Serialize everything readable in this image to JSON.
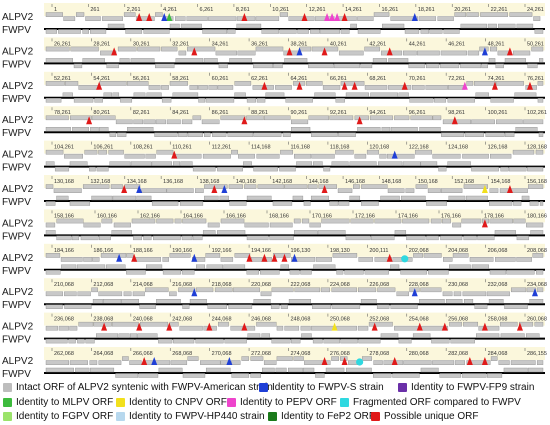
{
  "colors": {
    "band_bg": "#fbf7dc",
    "orf_fill": "#c8c8c8",
    "orf_stroke": "#8a8a8a",
    "fwpv_line": "#000000",
    "label": "#1a1a1a"
  },
  "blocks": [
    {
      "ticks": [
        "1",
        "261",
        "2,261",
        "4,261",
        "6,261",
        "8,261",
        "10,261",
        "12,261",
        "14,261",
        "16,261",
        "18,261",
        "20,261",
        "22,261",
        "24,261"
      ],
      "marks": [
        {
          "p": 0.19,
          "c": "red"
        },
        {
          "p": 0.21,
          "c": "red"
        },
        {
          "p": 0.25,
          "c": "green"
        },
        {
          "p": 0.24,
          "c": "blue"
        },
        {
          "p": 0.4,
          "c": "red"
        },
        {
          "p": 0.52,
          "c": "red"
        },
        {
          "p": 0.565,
          "c": "magenta"
        },
        {
          "p": 0.575,
          "c": "magenta"
        },
        {
          "p": 0.585,
          "c": "magenta"
        },
        {
          "p": 0.6,
          "c": "red"
        },
        {
          "p": 0.74,
          "c": "blue"
        }
      ]
    },
    {
      "ticks": [
        "26,261",
        "28,261",
        "30,261",
        "32,261",
        "34,261",
        "36,261",
        "38,261",
        "40,261",
        "42,261",
        "44,261",
        "46,261",
        "48,261",
        "50,261"
      ],
      "marks": [
        {
          "p": 0.14,
          "c": "red"
        },
        {
          "p": 0.3,
          "c": "red"
        },
        {
          "p": 0.49,
          "c": "red"
        },
        {
          "p": 0.51,
          "c": "blue"
        },
        {
          "p": 0.56,
          "c": "red"
        },
        {
          "p": 0.69,
          "c": "red"
        },
        {
          "p": 0.88,
          "c": "blue"
        },
        {
          "p": 0.93,
          "c": "red"
        }
      ]
    },
    {
      "ticks": [
        "52,261",
        "54,261",
        "56,261",
        "58,261",
        "60,261",
        "62,261",
        "64,261",
        "66,261",
        "68,261",
        "70,261",
        "72,261",
        "74,261",
        "76,261"
      ],
      "marks": [
        {
          "p": 0.11,
          "c": "red"
        },
        {
          "p": 0.44,
          "c": "red"
        },
        {
          "p": 0.51,
          "c": "red"
        },
        {
          "p": 0.6,
          "c": "red"
        },
        {
          "p": 0.62,
          "c": "red"
        },
        {
          "p": 0.72,
          "c": "red"
        },
        {
          "p": 0.84,
          "c": "magenta"
        },
        {
          "p": 0.9,
          "c": "red"
        },
        {
          "p": 0.97,
          "c": "red"
        }
      ]
    },
    {
      "ticks": [
        "78,261",
        "80,261",
        "82,261",
        "84,261",
        "86,261",
        "88,261",
        "90,261",
        "92,261",
        "94,261",
        "96,261",
        "98,261",
        "100,261",
        "102,261"
      ],
      "marks": [
        {
          "p": 0.09,
          "c": "red"
        },
        {
          "p": 0.4,
          "c": "red"
        },
        {
          "p": 0.63,
          "c": "red"
        },
        {
          "p": 0.82,
          "c": "red"
        }
      ]
    },
    {
      "ticks": [
        "104,261",
        "106,261",
        "108,261",
        "110,261",
        "112,261",
        "114,168",
        "116,168",
        "118,168",
        "120,168",
        "122,168",
        "124,168",
        "126,168",
        "128,168"
      ],
      "marks": [
        {
          "p": 0.26,
          "c": "red"
        },
        {
          "p": 0.7,
          "c": "blue"
        }
      ]
    },
    {
      "ticks": [
        "130,168",
        "132,168",
        "134,168",
        "136,168",
        "138,168",
        "140,168",
        "142,168",
        "144,168",
        "146,168",
        "148,168",
        "150,168",
        "152,168",
        "154,168",
        "156,168"
      ],
      "marks": [
        {
          "p": 0.16,
          "c": "red"
        },
        {
          "p": 0.19,
          "c": "blue"
        },
        {
          "p": 0.34,
          "c": "red"
        },
        {
          "p": 0.36,
          "c": "blue"
        },
        {
          "p": 0.56,
          "c": "red"
        },
        {
          "p": 0.88,
          "c": "yellow"
        },
        {
          "p": 0.93,
          "c": "red"
        }
      ]
    },
    {
      "ticks": [
        "158,166",
        "160,166",
        "162,166",
        "164,166",
        "166,166",
        "168,166",
        "170,166",
        "172,166",
        "174,166",
        "176,166",
        "178,166",
        "180,166"
      ],
      "marks": [
        {
          "p": 0.88,
          "c": "red"
        }
      ]
    },
    {
      "ticks": [
        "184,166",
        "186,166",
        "188,166",
        "190,166",
        "192,166",
        "194,166",
        "196,130",
        "198,130",
        "200,111",
        "202,068",
        "204,068",
        "206,068",
        "208,068"
      ],
      "marks": [
        {
          "p": 0.15,
          "c": "blue"
        },
        {
          "p": 0.18,
          "c": "red"
        },
        {
          "p": 0.3,
          "c": "blue"
        },
        {
          "p": 0.41,
          "c": "red"
        },
        {
          "p": 0.44,
          "c": "red"
        },
        {
          "p": 0.46,
          "c": "red"
        },
        {
          "p": 0.48,
          "c": "red"
        },
        {
          "p": 0.5,
          "c": "blue"
        },
        {
          "p": 0.69,
          "c": "red"
        },
        {
          "p": 0.72,
          "c": "cyan"
        }
      ]
    },
    {
      "ticks": [
        "210,068",
        "212,068",
        "214,068",
        "216,068",
        "218,068",
        "220,068",
        "222,068",
        "224,068",
        "226,068",
        "228,068",
        "230,068",
        "232,068",
        "234,068"
      ],
      "marks": [
        {
          "p": 0.3,
          "c": "blue"
        },
        {
          "p": 0.74,
          "c": "blue"
        },
        {
          "p": 0.98,
          "c": "blue"
        }
      ]
    },
    {
      "ticks": [
        "236,068",
        "238,068",
        "240,068",
        "242,068",
        "244,068",
        "246,068",
        "248,068",
        "250,068",
        "252,068",
        "254,068",
        "256,068",
        "258,068",
        "260,068"
      ],
      "marks": [
        {
          "p": 0.12,
          "c": "red"
        },
        {
          "p": 0.19,
          "c": "red"
        },
        {
          "p": 0.25,
          "c": "red"
        },
        {
          "p": 0.33,
          "c": "red"
        },
        {
          "p": 0.4,
          "c": "red"
        },
        {
          "p": 0.58,
          "c": "yellow"
        },
        {
          "p": 0.66,
          "c": "red"
        },
        {
          "p": 0.75,
          "c": "red"
        },
        {
          "p": 0.8,
          "c": "red"
        },
        {
          "p": 0.88,
          "c": "red"
        },
        {
          "p": 0.95,
          "c": "red"
        }
      ]
    },
    {
      "ticks": [
        "262,068",
        "264,068",
        "266,068",
        "268,068",
        "270,068",
        "272,068",
        "274,068",
        "276,068",
        "278,068",
        "280,068",
        "282,068",
        "284,068",
        "286,155"
      ],
      "marks": [
        {
          "p": 0.2,
          "c": "red"
        },
        {
          "p": 0.22,
          "c": "blue"
        },
        {
          "p": 0.37,
          "c": "blue"
        },
        {
          "p": 0.56,
          "c": "red"
        },
        {
          "p": 0.6,
          "c": "red"
        },
        {
          "p": 0.63,
          "c": "cyan"
        },
        {
          "p": 0.7,
          "c": "red"
        },
        {
          "p": 0.85,
          "c": "red"
        },
        {
          "p": 0.88,
          "c": "red"
        }
      ]
    }
  ],
  "row_labels": {
    "top": "ALPV2",
    "bottom": "FWPV"
  },
  "mark_colors": {
    "red": "#e01a1a",
    "blue": "#1f3fd6",
    "magenta": "#ee44cc",
    "green": "#3dbb3d",
    "cyan": "#2fd8e0",
    "yellow": "#f2e01c"
  },
  "legend": [
    {
      "label": "Intact ORF of ALPV2 syntenic with FWPV-American strain",
      "color": "#bdbdbd"
    },
    {
      "label": "Identity to FWPV-S strain",
      "color": "#1f3fd6"
    },
    {
      "label": "Identity to FWPV-FP9 strain",
      "color": "#6a2fa8"
    },
    {
      "label": "Identity to MLPV ORF",
      "color": "#3dbb3d"
    },
    {
      "label": "Identity to CNPV ORF",
      "color": "#f2e01c"
    },
    {
      "label": "Identity to PEPV ORF",
      "color": "#ee44cc"
    },
    {
      "label": "Fragmented ORF compared to FWPV",
      "color": "#2fd8e0"
    },
    {
      "label": "Identity to FGPV ORF",
      "color": "#9be36a"
    },
    {
      "label": "Identity to FWPV-HP440 strain",
      "color": "#b7d8ee"
    },
    {
      "label": "Identity to FeP2 ORF",
      "color": "#1a7a1a"
    },
    {
      "label": "Possible unique ORF",
      "color": "#e01a1a"
    }
  ]
}
